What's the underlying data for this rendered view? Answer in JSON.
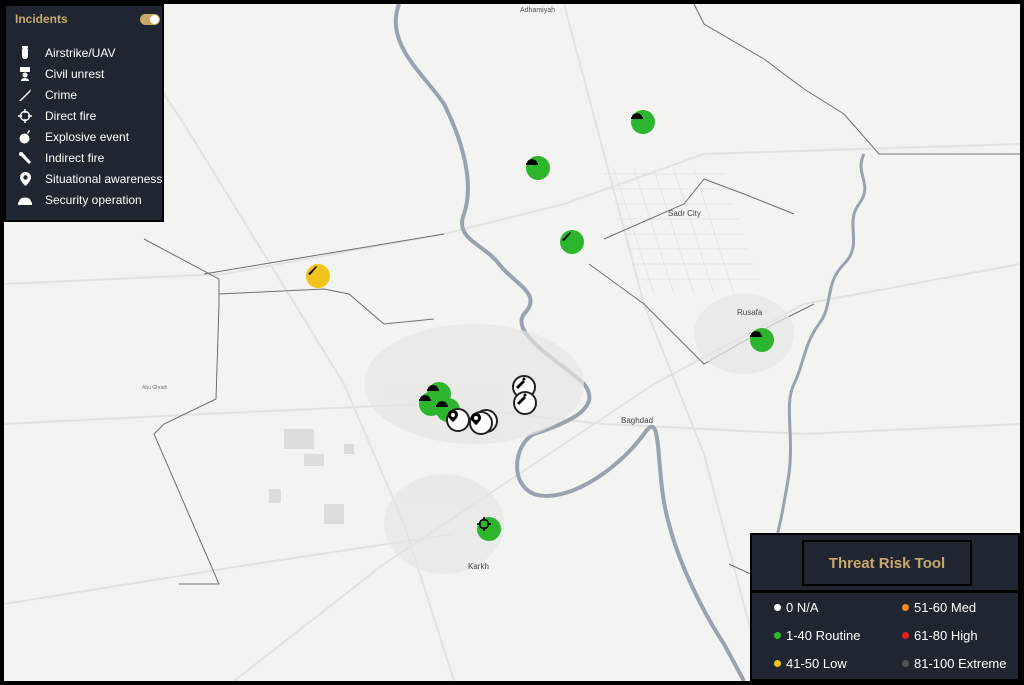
{
  "incidents": {
    "title": "Incidents",
    "toggle_on": true,
    "items": [
      {
        "label": "Airstrike/UAV",
        "icon": "bomb-icon"
      },
      {
        "label": "Civil unrest",
        "icon": "protester-icon"
      },
      {
        "label": "Crime",
        "icon": "knife-icon"
      },
      {
        "label": "Direct fire",
        "icon": "crosshair-icon"
      },
      {
        "label": "Explosive event",
        "icon": "explosion-icon"
      },
      {
        "label": "Indirect fire",
        "icon": "mortar-icon"
      },
      {
        "label": "Situational awareness",
        "icon": "location-pin-icon"
      },
      {
        "label": "Security operation",
        "icon": "helmet-icon"
      }
    ]
  },
  "threat_tool": {
    "title": "Threat Risk Tool",
    "levels": [
      {
        "label": "0 N/A",
        "color": "#ffffff"
      },
      {
        "label": "51-60 Med",
        "color": "#f28c1b"
      },
      {
        "label": "1-40 Routine",
        "color": "#2db52d"
      },
      {
        "label": "61-80 High",
        "color": "#e0221b"
      },
      {
        "label": "41-50 Low",
        "color": "#f2c31b"
      },
      {
        "label": "81-100 Extreme",
        "color": "#555555"
      }
    ]
  },
  "map": {
    "places": {
      "adhamiyah": "Adhamiyah",
      "sadr_city": "Sadr City",
      "rusafa": "Rusafa",
      "baghdad": "Baghdad",
      "karkh": "Karkh",
      "abu_ghraib": "Abu Ghraib"
    },
    "colors": {
      "green": "#2db52d",
      "yellow": "#f2c31b",
      "white": "#ffffff",
      "accent": "#c9a86a",
      "panel": "#1f2631"
    }
  }
}
